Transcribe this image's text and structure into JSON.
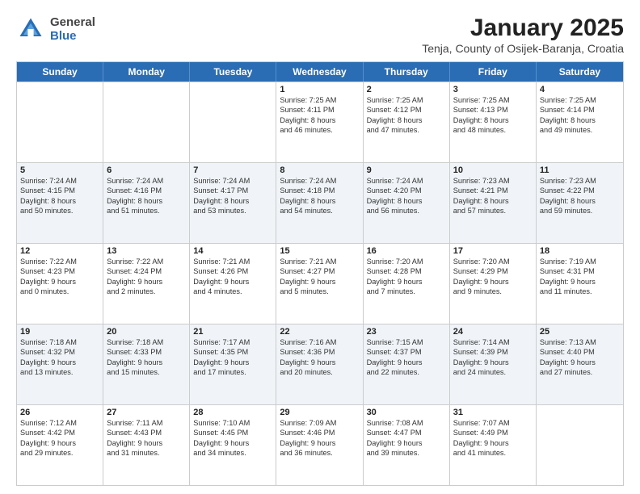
{
  "header": {
    "logo": {
      "general": "General",
      "blue": "Blue"
    },
    "title": "January 2025",
    "location": "Tenja, County of Osijek-Baranja, Croatia"
  },
  "weekdays": [
    "Sunday",
    "Monday",
    "Tuesday",
    "Wednesday",
    "Thursday",
    "Friday",
    "Saturday"
  ],
  "rows": [
    {
      "alt": false,
      "cells": [
        {
          "day": "",
          "lines": []
        },
        {
          "day": "",
          "lines": []
        },
        {
          "day": "",
          "lines": []
        },
        {
          "day": "1",
          "lines": [
            "Sunrise: 7:25 AM",
            "Sunset: 4:11 PM",
            "Daylight: 8 hours",
            "and 46 minutes."
          ]
        },
        {
          "day": "2",
          "lines": [
            "Sunrise: 7:25 AM",
            "Sunset: 4:12 PM",
            "Daylight: 8 hours",
            "and 47 minutes."
          ]
        },
        {
          "day": "3",
          "lines": [
            "Sunrise: 7:25 AM",
            "Sunset: 4:13 PM",
            "Daylight: 8 hours",
            "and 48 minutes."
          ]
        },
        {
          "day": "4",
          "lines": [
            "Sunrise: 7:25 AM",
            "Sunset: 4:14 PM",
            "Daylight: 8 hours",
            "and 49 minutes."
          ]
        }
      ]
    },
    {
      "alt": true,
      "cells": [
        {
          "day": "5",
          "lines": [
            "Sunrise: 7:24 AM",
            "Sunset: 4:15 PM",
            "Daylight: 8 hours",
            "and 50 minutes."
          ]
        },
        {
          "day": "6",
          "lines": [
            "Sunrise: 7:24 AM",
            "Sunset: 4:16 PM",
            "Daylight: 8 hours",
            "and 51 minutes."
          ]
        },
        {
          "day": "7",
          "lines": [
            "Sunrise: 7:24 AM",
            "Sunset: 4:17 PM",
            "Daylight: 8 hours",
            "and 53 minutes."
          ]
        },
        {
          "day": "8",
          "lines": [
            "Sunrise: 7:24 AM",
            "Sunset: 4:18 PM",
            "Daylight: 8 hours",
            "and 54 minutes."
          ]
        },
        {
          "day": "9",
          "lines": [
            "Sunrise: 7:24 AM",
            "Sunset: 4:20 PM",
            "Daylight: 8 hours",
            "and 56 minutes."
          ]
        },
        {
          "day": "10",
          "lines": [
            "Sunrise: 7:23 AM",
            "Sunset: 4:21 PM",
            "Daylight: 8 hours",
            "and 57 minutes."
          ]
        },
        {
          "day": "11",
          "lines": [
            "Sunrise: 7:23 AM",
            "Sunset: 4:22 PM",
            "Daylight: 8 hours",
            "and 59 minutes."
          ]
        }
      ]
    },
    {
      "alt": false,
      "cells": [
        {
          "day": "12",
          "lines": [
            "Sunrise: 7:22 AM",
            "Sunset: 4:23 PM",
            "Daylight: 9 hours",
            "and 0 minutes."
          ]
        },
        {
          "day": "13",
          "lines": [
            "Sunrise: 7:22 AM",
            "Sunset: 4:24 PM",
            "Daylight: 9 hours",
            "and 2 minutes."
          ]
        },
        {
          "day": "14",
          "lines": [
            "Sunrise: 7:21 AM",
            "Sunset: 4:26 PM",
            "Daylight: 9 hours",
            "and 4 minutes."
          ]
        },
        {
          "day": "15",
          "lines": [
            "Sunrise: 7:21 AM",
            "Sunset: 4:27 PM",
            "Daylight: 9 hours",
            "and 5 minutes."
          ]
        },
        {
          "day": "16",
          "lines": [
            "Sunrise: 7:20 AM",
            "Sunset: 4:28 PM",
            "Daylight: 9 hours",
            "and 7 minutes."
          ]
        },
        {
          "day": "17",
          "lines": [
            "Sunrise: 7:20 AM",
            "Sunset: 4:29 PM",
            "Daylight: 9 hours",
            "and 9 minutes."
          ]
        },
        {
          "day": "18",
          "lines": [
            "Sunrise: 7:19 AM",
            "Sunset: 4:31 PM",
            "Daylight: 9 hours",
            "and 11 minutes."
          ]
        }
      ]
    },
    {
      "alt": true,
      "cells": [
        {
          "day": "19",
          "lines": [
            "Sunrise: 7:18 AM",
            "Sunset: 4:32 PM",
            "Daylight: 9 hours",
            "and 13 minutes."
          ]
        },
        {
          "day": "20",
          "lines": [
            "Sunrise: 7:18 AM",
            "Sunset: 4:33 PM",
            "Daylight: 9 hours",
            "and 15 minutes."
          ]
        },
        {
          "day": "21",
          "lines": [
            "Sunrise: 7:17 AM",
            "Sunset: 4:35 PM",
            "Daylight: 9 hours",
            "and 17 minutes."
          ]
        },
        {
          "day": "22",
          "lines": [
            "Sunrise: 7:16 AM",
            "Sunset: 4:36 PM",
            "Daylight: 9 hours",
            "and 20 minutes."
          ]
        },
        {
          "day": "23",
          "lines": [
            "Sunrise: 7:15 AM",
            "Sunset: 4:37 PM",
            "Daylight: 9 hours",
            "and 22 minutes."
          ]
        },
        {
          "day": "24",
          "lines": [
            "Sunrise: 7:14 AM",
            "Sunset: 4:39 PM",
            "Daylight: 9 hours",
            "and 24 minutes."
          ]
        },
        {
          "day": "25",
          "lines": [
            "Sunrise: 7:13 AM",
            "Sunset: 4:40 PM",
            "Daylight: 9 hours",
            "and 27 minutes."
          ]
        }
      ]
    },
    {
      "alt": false,
      "cells": [
        {
          "day": "26",
          "lines": [
            "Sunrise: 7:12 AM",
            "Sunset: 4:42 PM",
            "Daylight: 9 hours",
            "and 29 minutes."
          ]
        },
        {
          "day": "27",
          "lines": [
            "Sunrise: 7:11 AM",
            "Sunset: 4:43 PM",
            "Daylight: 9 hours",
            "and 31 minutes."
          ]
        },
        {
          "day": "28",
          "lines": [
            "Sunrise: 7:10 AM",
            "Sunset: 4:45 PM",
            "Daylight: 9 hours",
            "and 34 minutes."
          ]
        },
        {
          "day": "29",
          "lines": [
            "Sunrise: 7:09 AM",
            "Sunset: 4:46 PM",
            "Daylight: 9 hours",
            "and 36 minutes."
          ]
        },
        {
          "day": "30",
          "lines": [
            "Sunrise: 7:08 AM",
            "Sunset: 4:47 PM",
            "Daylight: 9 hours",
            "and 39 minutes."
          ]
        },
        {
          "day": "31",
          "lines": [
            "Sunrise: 7:07 AM",
            "Sunset: 4:49 PM",
            "Daylight: 9 hours",
            "and 41 minutes."
          ]
        },
        {
          "day": "",
          "lines": []
        }
      ]
    }
  ]
}
